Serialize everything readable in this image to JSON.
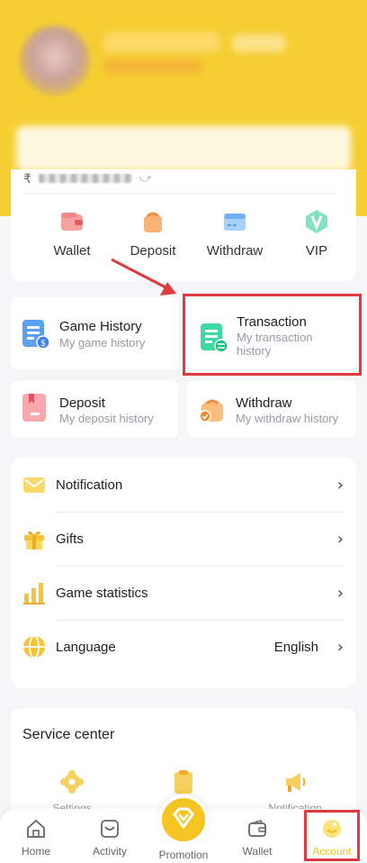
{
  "quick_actions": {
    "wallet": "Wallet",
    "deposit": "Deposit",
    "withdraw": "Withdraw",
    "vip": "VIP"
  },
  "balance": {
    "currency_symbol": "₹"
  },
  "history": {
    "game": {
      "title": "Game History",
      "sub": "My game history"
    },
    "transaction": {
      "title": "Transaction",
      "sub": "My transaction history"
    },
    "deposit": {
      "title": "Deposit",
      "sub": "My deposit history"
    },
    "withdraw": {
      "title": "Withdraw",
      "sub": "My withdraw history"
    }
  },
  "menu": {
    "notification": "Notification",
    "gifts": "Gifts",
    "game_statistics": "Game statistics",
    "language": "Language",
    "language_value": "English"
  },
  "service_center": {
    "title": "Service center",
    "items": [
      "Settings",
      "",
      "Notification"
    ]
  },
  "bottom_nav": {
    "home": "Home",
    "activity": "Activity",
    "promotion": "Promotion",
    "wallet": "Wallet",
    "account": "Account"
  },
  "colors": {
    "brand_yellow": "#f5cf32",
    "highlight_red": "#e0393e",
    "active_tab": "#f2c021"
  }
}
